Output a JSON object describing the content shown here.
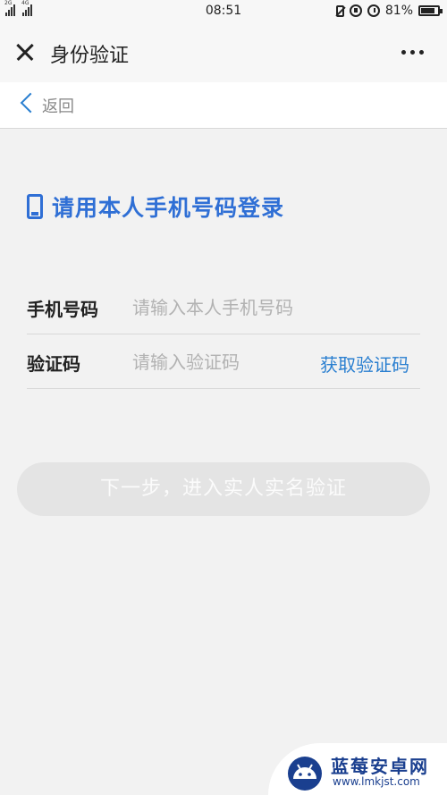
{
  "status_bar": {
    "sim1_network": "2G",
    "sim2_network": "4G",
    "time": "08:51",
    "battery_percent": "81%",
    "battery_level": 0.81,
    "icons": [
      "vibrate-icon",
      "data-saver-icon",
      "alarm-icon",
      "battery-icon"
    ]
  },
  "title_bar": {
    "close_icon": "close-icon",
    "title": "身份验证",
    "more_icon": "more-dots-icon"
  },
  "back_row": {
    "icon": "chevron-left-icon",
    "label": "返回"
  },
  "login": {
    "icon": "phone-icon",
    "heading": "请用本人手机号码登录",
    "accent_color": "#2f6fd5"
  },
  "form": {
    "phone": {
      "label": "手机号码",
      "value": "",
      "placeholder": "请输入本人手机号码"
    },
    "code": {
      "label": "验证码",
      "value": "",
      "placeholder": "请输入验证码",
      "get_code_label": "获取验证码"
    }
  },
  "next_button": {
    "label": "下一步，进入实人实名验证",
    "enabled": false
  },
  "watermark": {
    "title": "蓝莓安卓网",
    "url": "www.lmkjst.com"
  }
}
